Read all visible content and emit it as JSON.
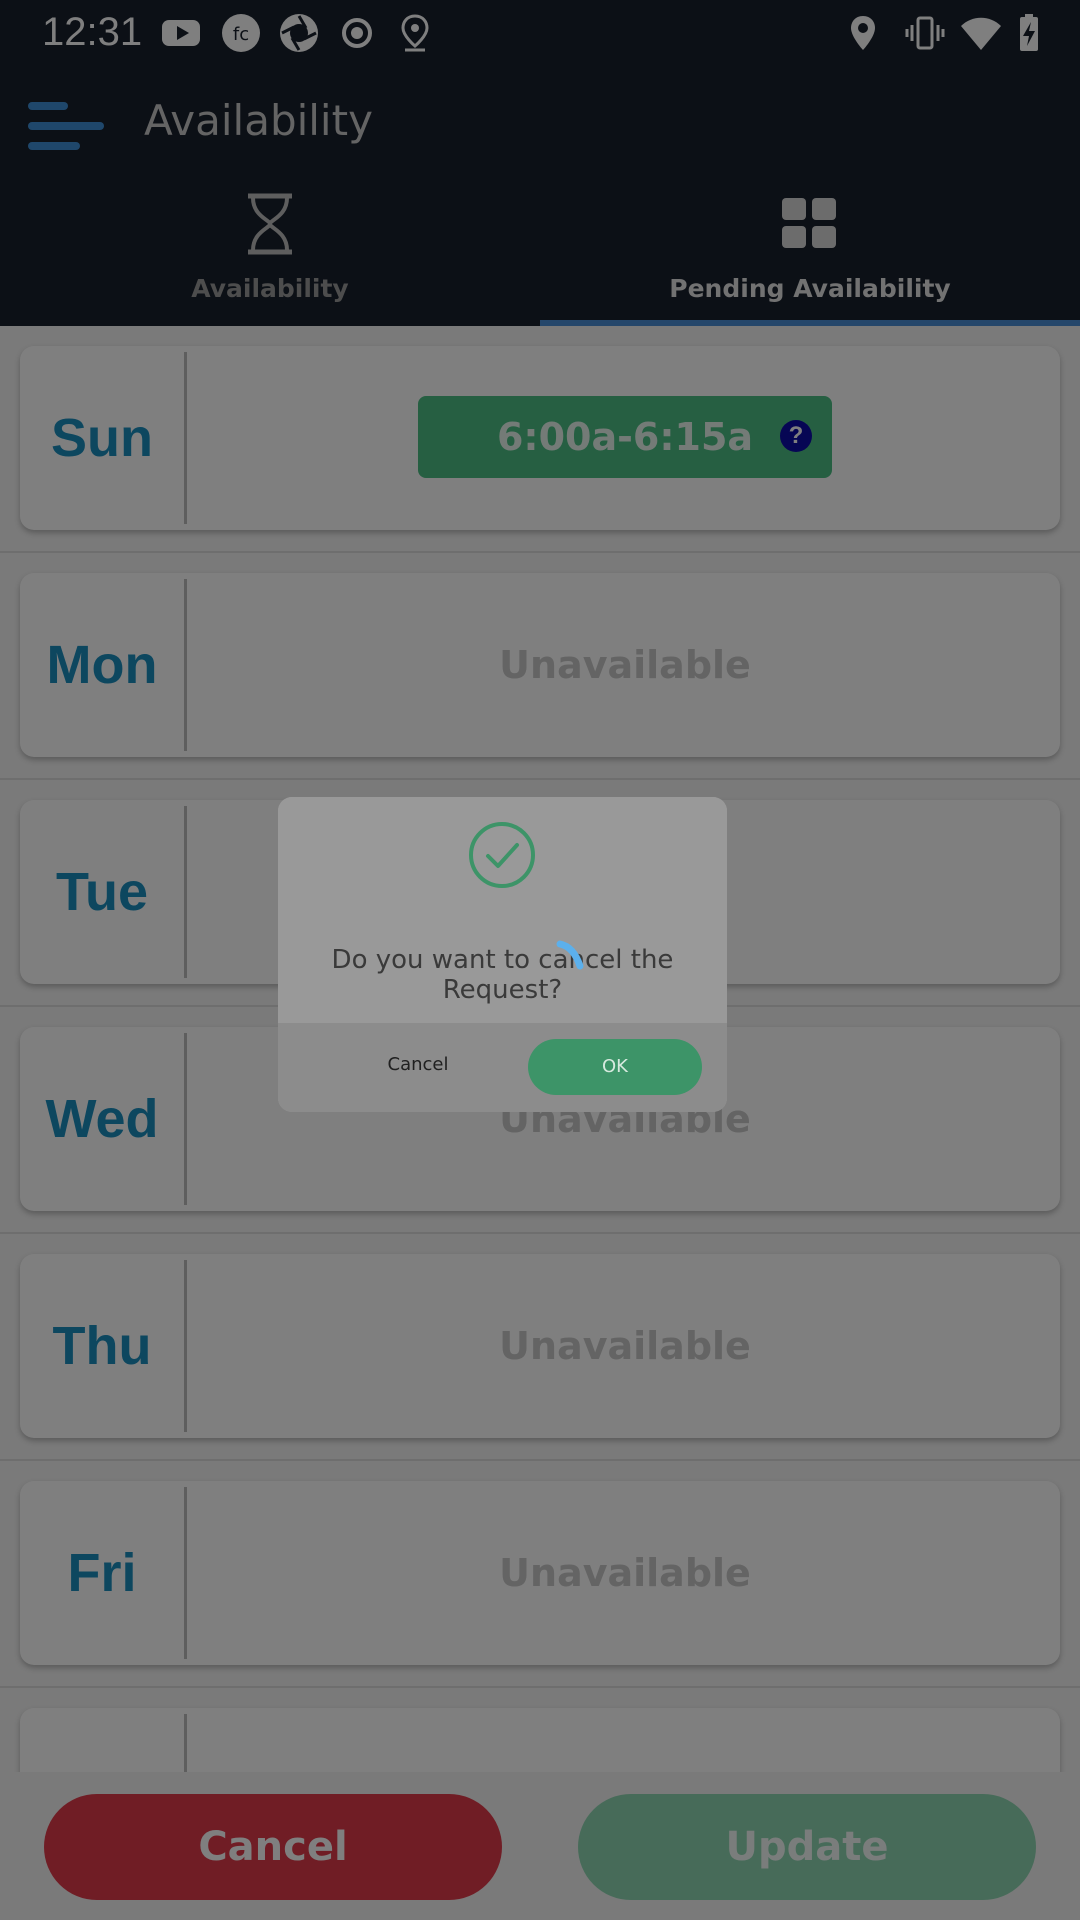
{
  "status_bar": {
    "time": "12:31",
    "left_icons": [
      "youtube-icon",
      "fc-app-icon",
      "camera-shutter-icon",
      "record-icon",
      "location-pin-outline-icon"
    ],
    "right_icons": [
      "location-icon",
      "vibrate-icon",
      "wifi-icon",
      "battery-charging-icon"
    ]
  },
  "app_bar": {
    "title": "Availability",
    "menu_icon": "hamburger-menu-icon"
  },
  "tabs": [
    {
      "label": "Availability",
      "icon": "hourglass-icon",
      "selected": false
    },
    {
      "label": "Pending Availability",
      "icon": "grid-icon",
      "selected": true
    }
  ],
  "days": [
    {
      "name": "Sun",
      "slot": "6:00a-6:15a"
    },
    {
      "name": "Mon",
      "status": "Unavailable"
    },
    {
      "name": "Tue",
      "status": ""
    },
    {
      "name": "Wed",
      "status": "Unavailable"
    },
    {
      "name": "Thu",
      "status": "Unavailable"
    },
    {
      "name": "Fri",
      "status": "Unavailable"
    },
    {
      "name": "",
      "status": ""
    }
  ],
  "bottom_buttons": {
    "cancel_label": "Cancel",
    "update_label": "Update"
  },
  "dialog": {
    "message": "Do you want to cancel the Request?",
    "cancel_label": "Cancel",
    "ok_label": "OK",
    "icon": "check-circle-icon"
  },
  "colors": {
    "app_bar_bg": "#19202d",
    "day_name": "#1a8fbf",
    "slot_chip": "#4cbf85",
    "cancel_button": "#e03a4a",
    "update_button": "#8fd7b3",
    "tab_underline": "#4a8fd6",
    "dialog_ok": "#3d9468"
  }
}
